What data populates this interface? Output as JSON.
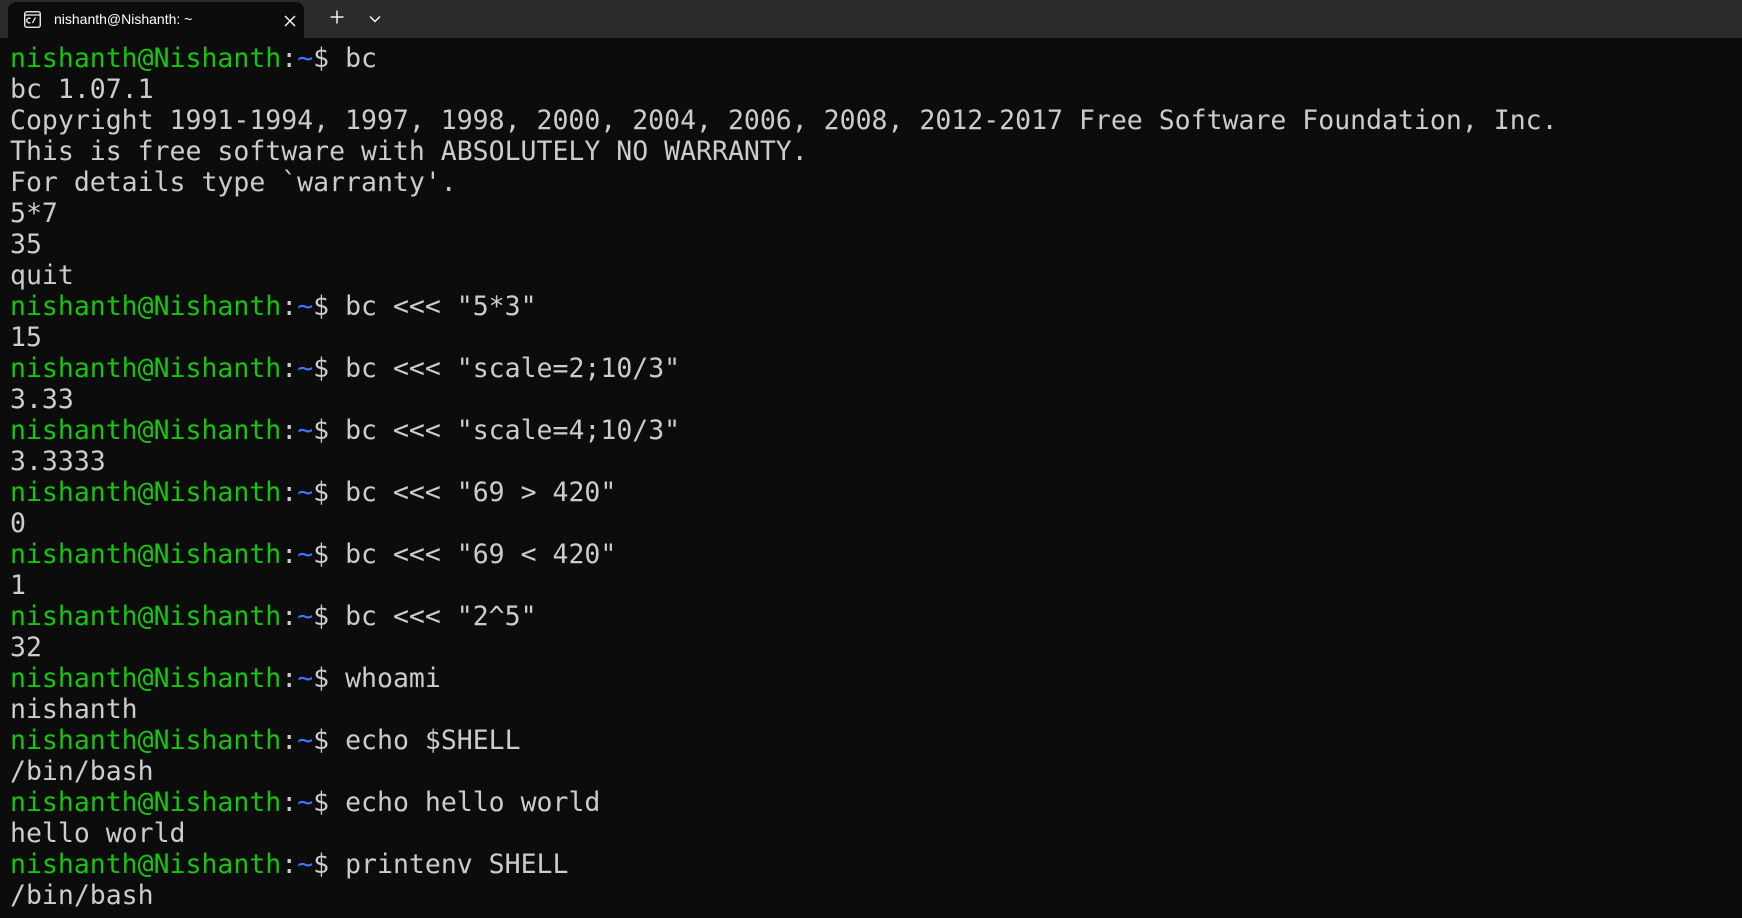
{
  "colors": {
    "titlebar_bg": "#2b2b2b",
    "terminal_bg": "#0c0c0c",
    "text": "#cccccc",
    "prompt_user": "#16c60c",
    "prompt_path": "#3b78ff"
  },
  "window": {
    "tab": {
      "icon": "terminal-icon",
      "title": "nishanth@Nishanth: ~",
      "close_icon": "close-icon"
    },
    "new_tab_icon": "plus-icon",
    "dropdown_icon": "chevron-down-icon"
  },
  "terminal": {
    "prompt": {
      "user_host": "nishanth@Nishanth",
      "colon": ":",
      "path": "~",
      "symbol": "$ "
    },
    "lines": [
      {
        "type": "prompt",
        "command": "bc"
      },
      {
        "type": "output",
        "text": "bc 1.07.1"
      },
      {
        "type": "output",
        "text": "Copyright 1991-1994, 1997, 1998, 2000, 2004, 2006, 2008, 2012-2017 Free Software Foundation, Inc."
      },
      {
        "type": "output",
        "text": "This is free software with ABSOLUTELY NO WARRANTY."
      },
      {
        "type": "output",
        "text": "For details type `warranty'."
      },
      {
        "type": "output",
        "text": "5*7"
      },
      {
        "type": "output",
        "text": "35"
      },
      {
        "type": "output",
        "text": "quit"
      },
      {
        "type": "prompt",
        "command": "bc <<< \"5*3\""
      },
      {
        "type": "output",
        "text": "15"
      },
      {
        "type": "prompt",
        "command": "bc <<< \"scale=2;10/3\""
      },
      {
        "type": "output",
        "text": "3.33"
      },
      {
        "type": "prompt",
        "command": "bc <<< \"scale=4;10/3\""
      },
      {
        "type": "output",
        "text": "3.3333"
      },
      {
        "type": "prompt",
        "command": "bc <<< \"69 > 420\""
      },
      {
        "type": "output",
        "text": "0"
      },
      {
        "type": "prompt",
        "command": "bc <<< \"69 < 420\""
      },
      {
        "type": "output",
        "text": "1"
      },
      {
        "type": "prompt",
        "command": "bc <<< \"2^5\""
      },
      {
        "type": "output",
        "text": "32"
      },
      {
        "type": "prompt",
        "command": "whoami"
      },
      {
        "type": "output",
        "text": "nishanth"
      },
      {
        "type": "prompt",
        "command": "echo $SHELL"
      },
      {
        "type": "output",
        "text": "/bin/bash"
      },
      {
        "type": "prompt",
        "command": "echo hello world"
      },
      {
        "type": "output",
        "text": "hello world"
      },
      {
        "type": "prompt",
        "command": "printenv SHELL"
      },
      {
        "type": "output",
        "text": "/bin/bash"
      }
    ]
  }
}
